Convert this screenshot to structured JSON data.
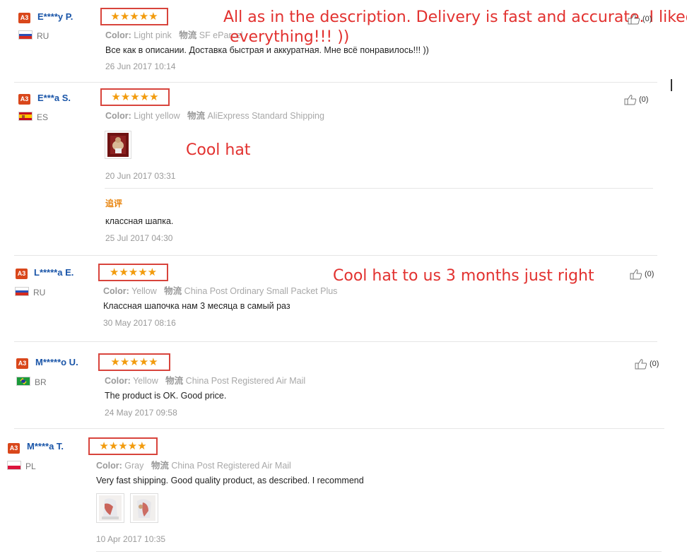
{
  "reviews": [
    {
      "level": "A3",
      "name": "E****y P.",
      "country": "RU",
      "stars": "★★★★★",
      "color_label": "Color:",
      "color_value": "Light pink",
      "logistics_label": "物流",
      "logistics_value": "SF eParcel",
      "text": "Все как в описании. Доставка быстрая и аккуратная. Мне всё понравилось!!! ))",
      "date": "26 Jun 2017 10:14",
      "translation_line1": "All as in the description. Delivery is fast and accurate. I liked",
      "translation_line2": "everything!!! ))",
      "helpful": "(0)"
    },
    {
      "level": "A3",
      "name": "E***a S.",
      "country": "ES",
      "stars": "★★★★★",
      "color_label": "Color:",
      "color_value": "Light yellow",
      "logistics_label": "物流",
      "logistics_value": "AliExpress Standard Shipping",
      "translation": "Cool hat",
      "date": "20 Jun 2017 03:31",
      "additional_label": "追评",
      "additional_text": "классная шапка.",
      "additional_date": "25 Jul 2017 04:30",
      "helpful": "(0)"
    },
    {
      "level": "A3",
      "name": "L*****a E.",
      "country": "RU",
      "stars": "★★★★★",
      "color_label": "Color:",
      "color_value": "Yellow",
      "logistics_label": "物流",
      "logistics_value": "China Post Ordinary Small Packet Plus",
      "text": "Классная шапочка нам 3 месяца в самый раз",
      "date": "30 May 2017 08:16",
      "translation": "Cool hat to us 3 months just right",
      "helpful": "(0)"
    },
    {
      "level": "A3",
      "name": "M*****o U.",
      "country": "BR",
      "stars": "★★★★★",
      "color_label": "Color:",
      "color_value": "Yellow",
      "logistics_label": "物流",
      "logistics_value": "China Post Registered Air Mail",
      "text": "The product is OK. Good price.",
      "date": "24 May 2017 09:58",
      "helpful": "(0)"
    },
    {
      "level": "A3",
      "name": "M****a T.",
      "country": "PL",
      "stars": "★★★★★",
      "color_label": "Color:",
      "color_value": "Gray",
      "logistics_label": "物流",
      "logistics_value": "China Post Registered Air Mail",
      "text": "Very fast shipping. Good quality product, as described. I recommend",
      "date": "10 Apr 2017 10:35"
    }
  ],
  "colors": {
    "annotation": "#e2312f",
    "star": "#f29b0d",
    "box": "#d8443c",
    "name": "#1a55a8",
    "level_badge": "#d9471b"
  }
}
